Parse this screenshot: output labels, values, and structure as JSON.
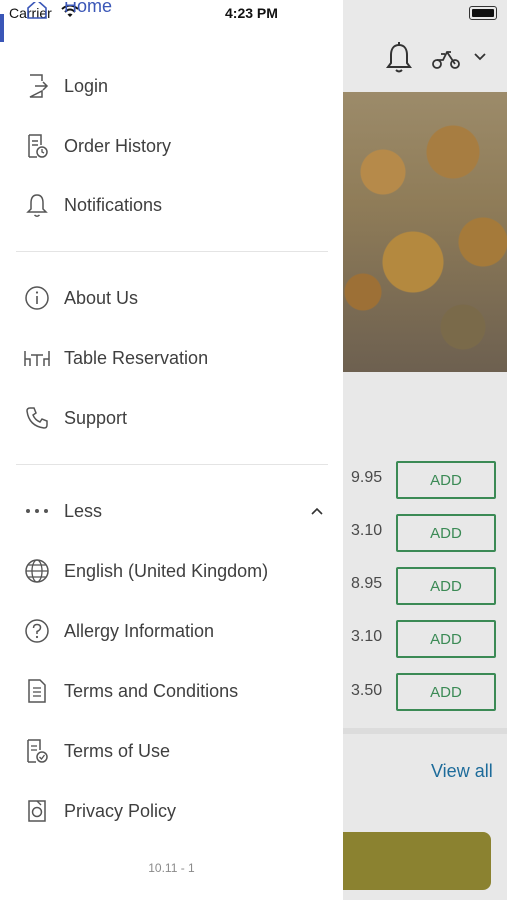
{
  "status_bar": {
    "carrier": "Carrier",
    "time": "4:23 PM"
  },
  "menu": {
    "home": "Home",
    "login": "Login",
    "order_history": "Order History",
    "notifications": "Notifications",
    "about_us": "About Us",
    "table_reservation": "Table Reservation",
    "support": "Support",
    "less": "Less",
    "language": "English (United Kingdom)",
    "allergy": "Allergy Information",
    "terms_conditions": "Terms and Conditions",
    "terms_of_use": "Terms of Use",
    "privacy_policy": "Privacy Policy"
  },
  "version": "10.11 - 1",
  "background": {
    "prices": [
      "9.95",
      "3.10",
      "8.95",
      "3.10",
      "3.50"
    ],
    "add_label": "ADD",
    "view_all": "View all"
  },
  "colors": {
    "accent": "#3a56b7",
    "add_green": "#3b8a55",
    "link": "#1d6b9a",
    "cta": "#8b8230"
  }
}
